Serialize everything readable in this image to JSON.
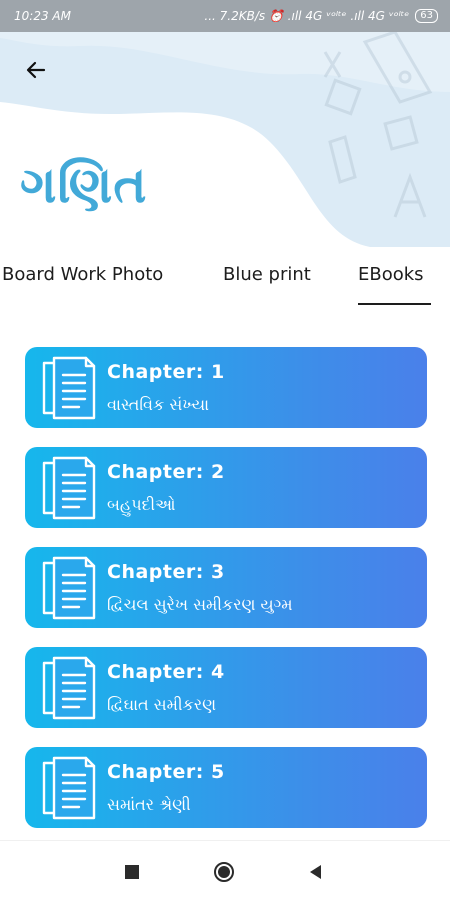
{
  "status_bar": {
    "time": "10:23 AM",
    "indicators": "... 7.2KB/s ⏰ .ıll 4G ᵛᵒˡᵗᵉ .ıll 4G ᵛᵒˡᵗᵉ",
    "battery": "63"
  },
  "header": {
    "title": "ગણિત"
  },
  "tabs": [
    {
      "label": "Board Work Photo"
    },
    {
      "label": "Blue print"
    },
    {
      "label": "EBooks"
    }
  ],
  "chapters": [
    {
      "number": "Chapter: 1",
      "name": "વાસ્તવિક સંખ્યા"
    },
    {
      "number": "Chapter: 2",
      "name": "બહુપદીઓ"
    },
    {
      "number": "Chapter: 3",
      "name": "દ્વિચલ સુરેખ સમીકરણ યુગ્મ"
    },
    {
      "number": "Chapter: 4",
      "name": "દ્વિઘાત સમીકરણ"
    },
    {
      "number": "Chapter: 5",
      "name": "સમાંતર શ્રેણી"
    }
  ],
  "icons": {
    "back": "back-arrow-icon",
    "document": "document-icon",
    "recent": "square-icon",
    "home": "circle-icon",
    "nav_back": "triangle-icon"
  },
  "colors": {
    "title": "#42a9d8",
    "card_start": "#16b7ec",
    "card_end": "#4a80ea"
  }
}
